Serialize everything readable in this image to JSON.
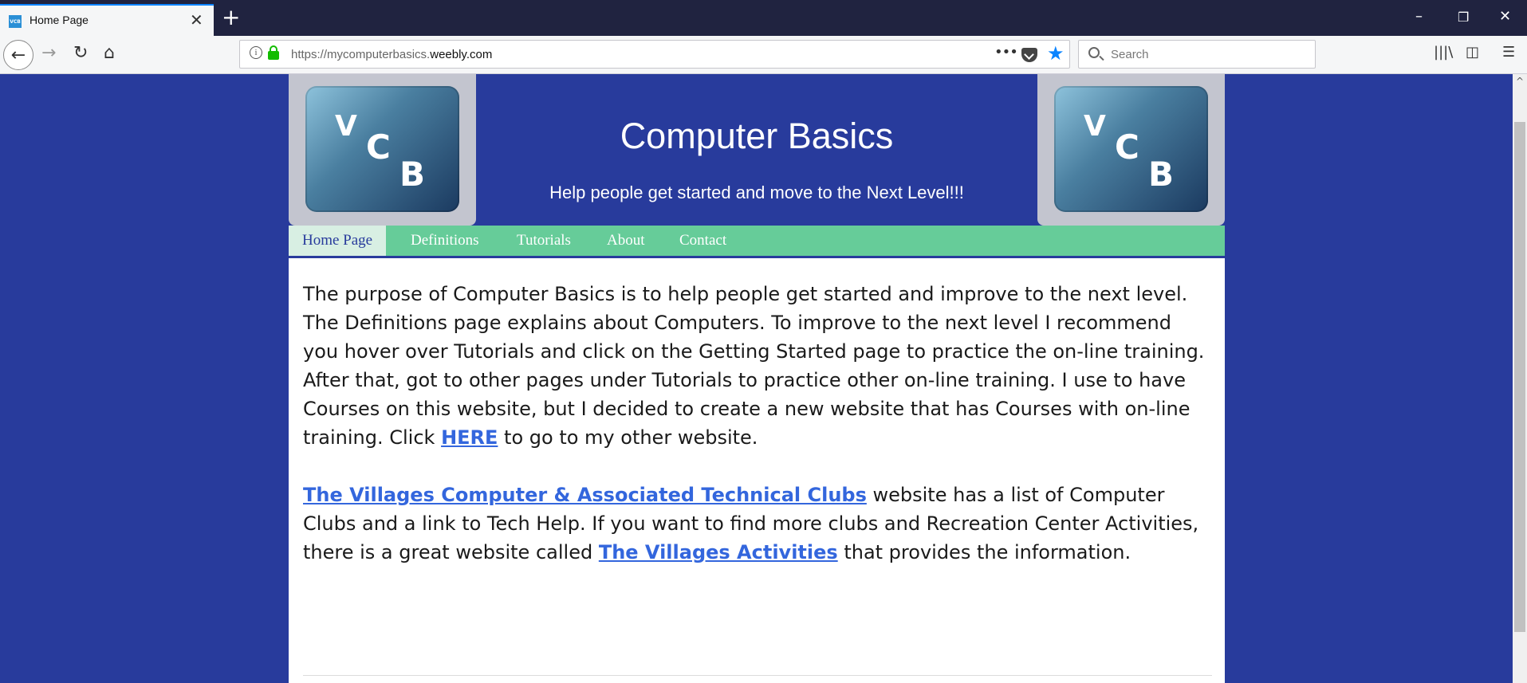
{
  "browser": {
    "tab_title": "Home Page",
    "tab_favicon_text": "VCB",
    "url_prefix": "https://mycomputerbasics.",
    "url_domain": "weebly.com",
    "search_placeholder": "Search",
    "page_actions_label": "•••"
  },
  "header": {
    "logo_letters": {
      "v": "V",
      "c": "C",
      "b": "B"
    },
    "title": "Computer Basics",
    "tagline": "Help people get started and move to the Next Level!!!"
  },
  "nav": {
    "items": [
      {
        "label": "Home Page",
        "active": true
      },
      {
        "label": "Definitions"
      },
      {
        "label": "Tutorials"
      },
      {
        "label": "About"
      },
      {
        "label": "Contact"
      }
    ]
  },
  "content": {
    "p1_text": "The purpose of Computer Basics is to help people get started and improve to the next level.  The Definitions page explains about Computers.  To improve to the next level I recommend you hover over Tutorials and click on the Getting Started page to practice the on-line training.  After that, got to other pages under Tutorials to practice other on-line training.  I use to have Courses on this website, but I decided to create a new website that has Courses with on-line training.  Click ",
    "p1_link": "HERE",
    "p1_tail": " to go to my other website.",
    "p2_link1": "The Villages Computer & Associated Technical Clubs",
    "p2_mid": " website has a list of Computer Clubs and a link to Tech Help.  If you want to find more clubs and Recreation Center Activities, there is a great website called ",
    "p2_link2": "The Villages Activities",
    "p2_tail": " that provides the information."
  },
  "colors": {
    "page_bg": "#283b9c",
    "nav_bg": "#66cc99",
    "link": "#3366dd"
  }
}
